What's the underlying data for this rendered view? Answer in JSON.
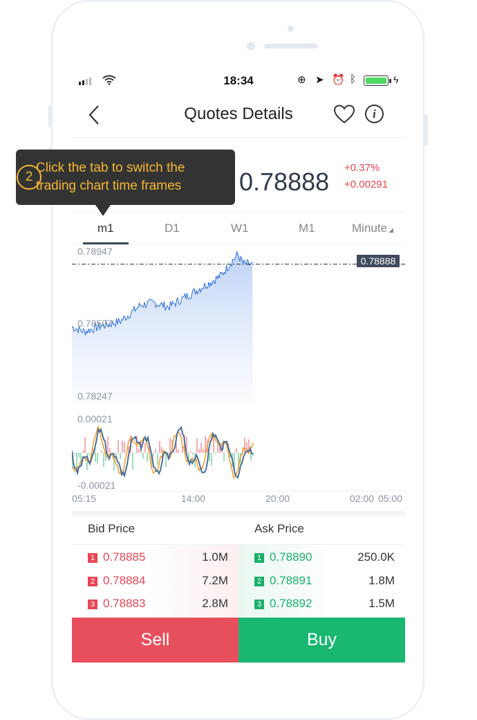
{
  "status_bar": {
    "time": "18:34"
  },
  "nav": {
    "title": "Quotes Details"
  },
  "quote": {
    "price": "0.78888",
    "change_pct": "+0.37%",
    "change_abs": "+0.00291"
  },
  "tabs": [
    "m1",
    "D1",
    "W1",
    "M1",
    "Minute"
  ],
  "active_tab": "m1",
  "chart": {
    "price_high": "0.78947",
    "price_mid": "0.78597",
    "price_low": "0.78247",
    "current_price_tag": "0.78888",
    "osc_high": "0.00021",
    "osc_low": "-0.00021",
    "time_labels": [
      "05:15",
      "14:00",
      "20:00",
      "02:00",
      "05:00"
    ]
  },
  "chart_data": {
    "type": "line",
    "x": [
      "05:15",
      "14:00",
      "20:00",
      "02:00",
      "05:00"
    ],
    "ylim": [
      0.78247,
      0.78947
    ],
    "current": 0.78888
  },
  "orderbook": {
    "bid_header": "Bid Price",
    "ask_header": "Ask Price",
    "bids": [
      {
        "rank": "1",
        "price": "0.78885",
        "volume": "1.0M"
      },
      {
        "rank": "2",
        "price": "0.78884",
        "volume": "7.2M"
      },
      {
        "rank": "3",
        "price": "0.78883",
        "volume": "2.8M"
      }
    ],
    "asks": [
      {
        "rank": "1",
        "price": "0.78890",
        "volume": "250.0K"
      },
      {
        "rank": "2",
        "price": "0.78891",
        "volume": "1.8M"
      },
      {
        "rank": "3",
        "price": "0.78892",
        "volume": "1.5M"
      }
    ]
  },
  "actions": {
    "sell": "Sell",
    "buy": "Buy"
  },
  "tooltip": {
    "step": "2",
    "line1": "Click the tab to switch the",
    "line2": "trading chart time frames"
  },
  "colors": {
    "accent_tip": "#f5b834",
    "sell": "#e84f5d",
    "buy": "#19b772",
    "down": "#e64553",
    "up": "#19b06a",
    "line": "#2c6fd8"
  }
}
